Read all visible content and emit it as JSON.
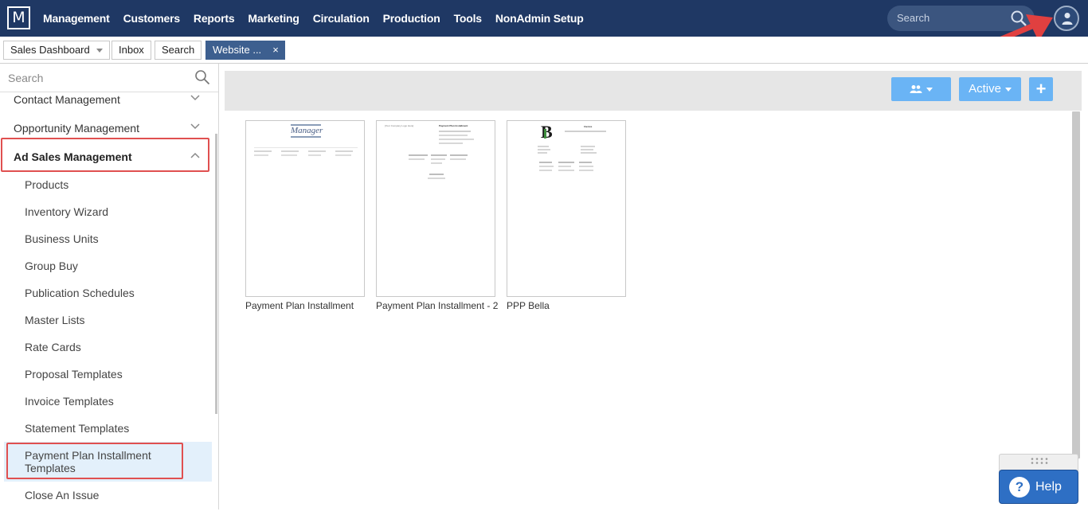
{
  "app": {
    "logo_letter": "M",
    "nav": [
      "Management",
      "Customers",
      "Reports",
      "Marketing",
      "Circulation",
      "Production",
      "Tools",
      "NonAdmin Setup"
    ],
    "search_placeholder": "Search"
  },
  "tabs": [
    {
      "label": "Sales Dashboard",
      "has_caret": true
    },
    {
      "label": "Inbox"
    },
    {
      "label": "Search"
    },
    {
      "label": "Website ...",
      "active": true,
      "close": "×"
    }
  ],
  "sidebar": {
    "search_placeholder": "Search",
    "sections": [
      {
        "label": "Contact Management",
        "expanded": false
      },
      {
        "label": "Opportunity Management",
        "expanded": false
      },
      {
        "label": "Ad Sales Management",
        "expanded": true
      }
    ],
    "items": [
      "Products",
      "Inventory Wizard",
      "Business Units",
      "Group Buy",
      "Publication Schedules",
      "Master Lists",
      "Rate Cards",
      "Proposal Templates",
      "Invoice Templates",
      "Statement Templates",
      "Payment Plan Installment Templates",
      "Close An Issue"
    ],
    "selected_item": "Payment Plan Installment Templates"
  },
  "toolbar": {
    "filter_label": "Active",
    "add_label": "+",
    "group_icon": "users-icon"
  },
  "templates": [
    {
      "name": "Payment Plan Installment",
      "thumb_logo": "Manager"
    },
    {
      "name": "Payment Plan Installment - 2",
      "thumb_title": "Payment Plan Installment",
      "thumb_logo": "[Your Company Logo Here]"
    },
    {
      "name": "PPP Bella",
      "thumb_title": "Invoice",
      "thumb_logo": "B"
    }
  ],
  "help": {
    "label": "Help",
    "icon": "?"
  },
  "colors": {
    "topbar": "#1f3864",
    "accent_button": "#6ab4f5",
    "active_tab": "#3d5f8f",
    "highlight": "#e05050",
    "help_button": "#2e6fc4"
  }
}
